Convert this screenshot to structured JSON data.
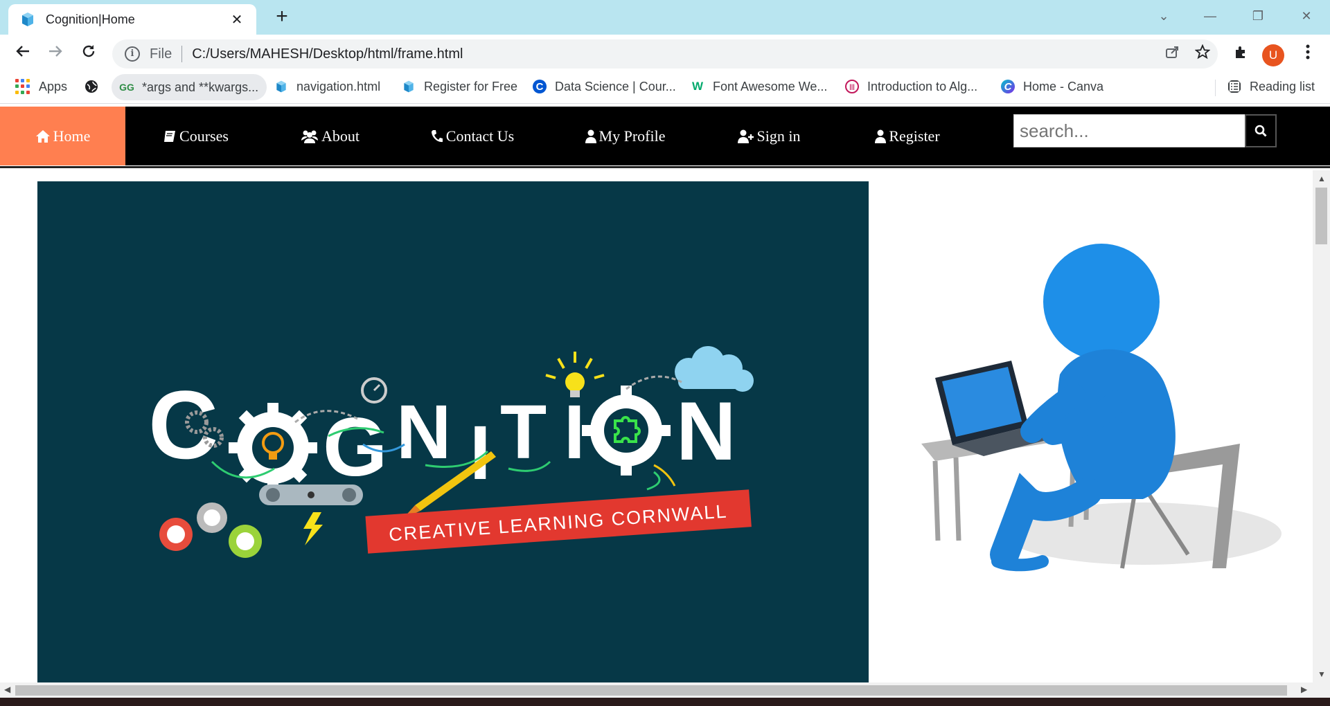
{
  "browser": {
    "tab": {
      "title": "Cognition|Home",
      "close": "✕"
    },
    "new_tab": "+",
    "window_controls": {
      "dropdown": "⌄",
      "minimize": "—",
      "restore": "❐",
      "close": "✕"
    },
    "omnibox": {
      "scheme_label": "File",
      "url": "C:/Users/MAHESH/Desktop/html/frame.html"
    },
    "profile_initial": "U",
    "bookmarks": [
      {
        "label": "Apps",
        "icon": "apps-grid"
      },
      {
        "label": "",
        "icon": "globe-icon"
      },
      {
        "label": "*args and **kwargs...",
        "icon": "geeksforgeeks-icon"
      },
      {
        "label": "navigation.html",
        "icon": "cube-icon"
      },
      {
        "label": "Register for Free",
        "icon": "cube-icon"
      },
      {
        "label": "Data Science | Cour...",
        "icon": "coursera-icon"
      },
      {
        "label": "Font Awesome We...",
        "icon": "w3schools-icon"
      },
      {
        "label": "Introduction to Alg...",
        "icon": "mit-icon"
      },
      {
        "label": "Home - Canva",
        "icon": "canva-icon"
      }
    ],
    "reading_list": "Reading list"
  },
  "site": {
    "nav": [
      {
        "label": "Home",
        "icon": "home-icon",
        "active": true
      },
      {
        "label": " Courses",
        "icon": "book-icon",
        "active": false
      },
      {
        "label": "About",
        "icon": "users-icon",
        "active": false
      },
      {
        "label": "Contact Us",
        "icon": "phone-icon",
        "active": false
      },
      {
        "label": "My Profile",
        "icon": "user-icon",
        "active": false
      },
      {
        "label": "Sign in",
        "icon": "user-plus-icon",
        "active": false
      },
      {
        "label": "Register",
        "icon": "user-icon",
        "active": false
      }
    ],
    "search": {
      "placeholder": "search..."
    },
    "hero": {
      "logo_text": "COGNITION",
      "tagline": "CREATIVE LEARNING CORNWALL"
    },
    "colors": {
      "nav_bg": "#000000",
      "active_bg": "#ff7f50",
      "hero_bg": "#063847",
      "figure_blue": "#1e90e8"
    }
  }
}
